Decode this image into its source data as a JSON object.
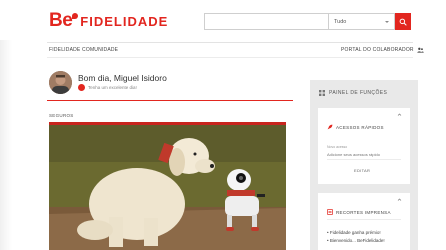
{
  "header": {
    "logo_be": "Be",
    "logo_text": "FIDELIDADE",
    "search": {
      "placeholder": "",
      "filter_selected": "Tudo"
    }
  },
  "nav": {
    "left_label": "FIDELIDADE COMUNIDADE",
    "right_label": "PORTAL DO COLABORADOR"
  },
  "greeting": {
    "text": "Bom dia, Miguel Isidoro",
    "mood": "Tenha um excelente dia!"
  },
  "main": {
    "section_label": "SEGUROS"
  },
  "side_panel": {
    "title": "PAINEL DE FUNÇÕES",
    "quick_access": {
      "title": "ACESSOS RÁPIDOS",
      "field_label": "Novo acesso",
      "field_placeholder": "Adicione seus acessos rápido",
      "button_label": "EDITAR"
    },
    "press": {
      "title": "RECORTES IMPRENSA",
      "items": [
        "• Fidelidade ganha prémio!",
        "• Bienvenido... BeFidelidade!"
      ]
    }
  },
  "colors": {
    "brand_red": "#e2261f",
    "panel_gray": "#e9e9e9"
  }
}
